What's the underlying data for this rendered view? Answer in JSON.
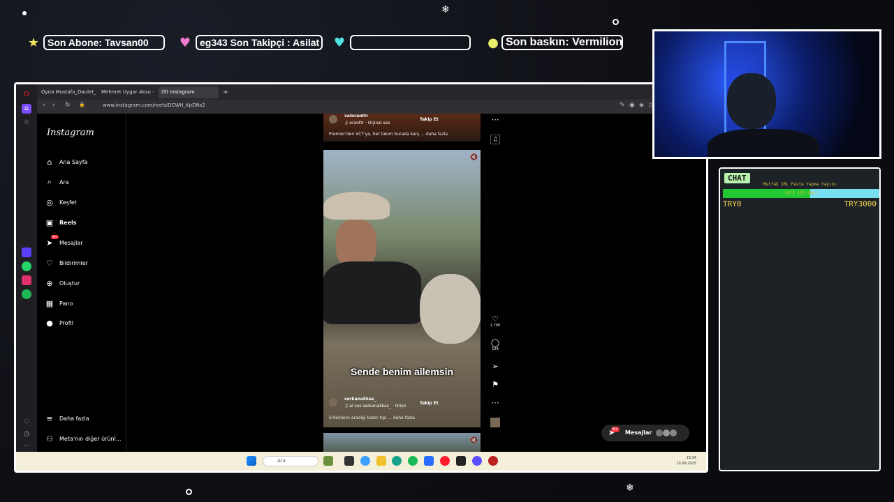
{
  "overlay": {
    "son_abone": "Son Abone: Tavsan00",
    "takipci": "eg343    Son Takipçi : Asilat",
    "gift": "",
    "baskin": "Son baskın: Vermilionn"
  },
  "browser": {
    "tabs": [
      "Oyna Mustafa_Daulet_09 -",
      "Mehmet Uygar Aksu - Ad",
      "(9) Instagram"
    ],
    "url": "www.instagram.com/reels/DCWH_KpDNs2"
  },
  "instagram": {
    "logo": "Instagram",
    "nav": [
      {
        "label": "Ana Sayfa",
        "icon": "home-icon"
      },
      {
        "label": "Ara",
        "icon": "search-icon"
      },
      {
        "label": "Keşfet",
        "icon": "compass-icon"
      },
      {
        "label": "Reels",
        "icon": "reels-icon"
      },
      {
        "label": "Mesajlar",
        "icon": "messages-icon",
        "badge": "9+"
      },
      {
        "label": "Bildirimler",
        "icon": "heart-icon"
      },
      {
        "label": "Oluştur",
        "icon": "plus-icon"
      },
      {
        "label": "Pano",
        "icon": "dashboard-icon"
      },
      {
        "label": "Profil",
        "icon": "profile-icon"
      }
    ],
    "more": "Daha fazla",
    "meta": "Meta'nın diğer ürünl...",
    "prev_reel": {
      "user": "valoranttr",
      "audio": "♫ oranttr · Orjinal ses",
      "follow": "Takip Et",
      "desc": "Premier'den VCT'ye, her takım burada karş ... daha fazla"
    },
    "reel": {
      "caption": "Sende benim ailemsin",
      "user": "serkanakkas_",
      "audio": "♫ al ses          serkanakkas_ · Orijin",
      "follow": "Takip Et",
      "desc": "Erkeklerin aradığı kadın tipi ... daha fazla",
      "likes": "1.700",
      "comments": "128"
    },
    "messages_pill": "Mesajlar",
    "messages_badge": "9+"
  },
  "taskbar": {
    "search": "Ara",
    "time": "23:34",
    "date": "10.09.2025"
  },
  "chat": {
    "title": "CHAT",
    "goal_label": "Mutfak IRL Pasta Yapma Yayını",
    "goal_pct_text": "1675 (55.90%)",
    "goal_fraction": 0.559,
    "goal_min": "TRY0",
    "goal_max": "TRY3000"
  },
  "colors": {
    "chat_title_bg": "#b7f1b0",
    "goal_fill": "#22c832",
    "goal_bg": "#78dff0",
    "instagram_badge": "#ff3040"
  }
}
